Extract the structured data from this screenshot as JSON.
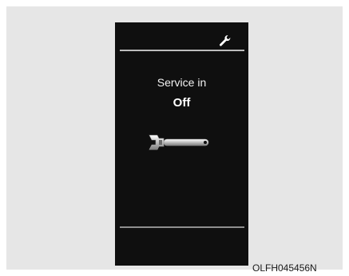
{
  "screen": {
    "title": "Service in",
    "value": "Off",
    "header_icon": "wrench-icon",
    "center_icon": "adjustable-wrench-icon"
  },
  "caption": "OLFH045456N",
  "colors": {
    "screen_bg": "#0f0f0f",
    "frame_bg": "#e6e6e6",
    "text": "#ffffff"
  }
}
